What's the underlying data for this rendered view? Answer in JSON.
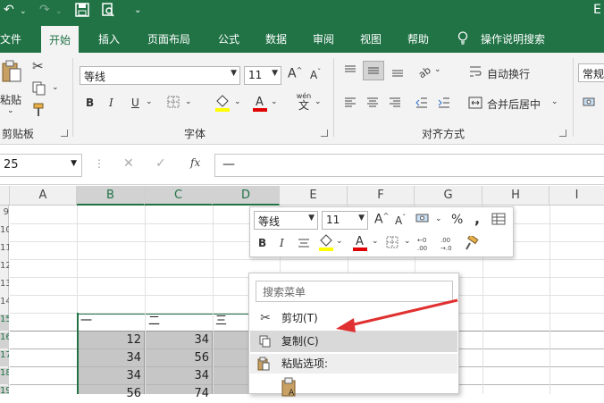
{
  "titlebar": {
    "right_text": "E"
  },
  "tabs": {
    "file": "文件",
    "home": "开始",
    "insert": "插入",
    "layout": "页面布局",
    "formulas": "公式",
    "data": "数据",
    "review": "审阅",
    "view": "视图",
    "help": "帮助",
    "tellme": "操作说明搜索"
  },
  "ribbon": {
    "clipboard": {
      "paste": "粘贴",
      "label": "剪贴板"
    },
    "font": {
      "name": "等线",
      "size": "11",
      "label": "字体",
      "bold": "B",
      "italic": "I",
      "underline": "U",
      "grow": "A",
      "shrink": "A",
      "wen": "wén",
      "wen_char": "文"
    },
    "alignment": {
      "wrap": "自动换行",
      "merge": "合并后居中",
      "label": "对齐方式"
    },
    "number": {
      "format": "常规"
    }
  },
  "formulabar": {
    "namebox": "25",
    "content": "—",
    "fx": "fx"
  },
  "columns": [
    "A",
    "B",
    "C",
    "D",
    "E",
    "F",
    "G",
    "H",
    "I"
  ],
  "rows": [
    "9",
    "10",
    "11",
    "12",
    "13",
    "14",
    "15",
    "16",
    "17",
    "18",
    "19"
  ],
  "cells": {
    "b15": "一",
    "c15": "二",
    "d15": "三",
    "b16": "12",
    "c16": "34",
    "b17": "34",
    "c17": "56",
    "b18": "34",
    "c18": "34",
    "b19": "56",
    "c19": "74"
  },
  "minitoolbar": {
    "font": "等线",
    "size": "11",
    "bold": "B",
    "italic": "I",
    "percent": "%",
    "comma": ","
  },
  "contextmenu": {
    "search_placeholder": "搜索菜单",
    "cut": "剪切(T)",
    "copy": "复制(C)",
    "paste_options": "粘贴选项:"
  },
  "colors": {
    "brand": "#217346",
    "arrow": "#e03030",
    "font_color_bar": "#e00000",
    "highlight_bar": "#ffff00"
  }
}
